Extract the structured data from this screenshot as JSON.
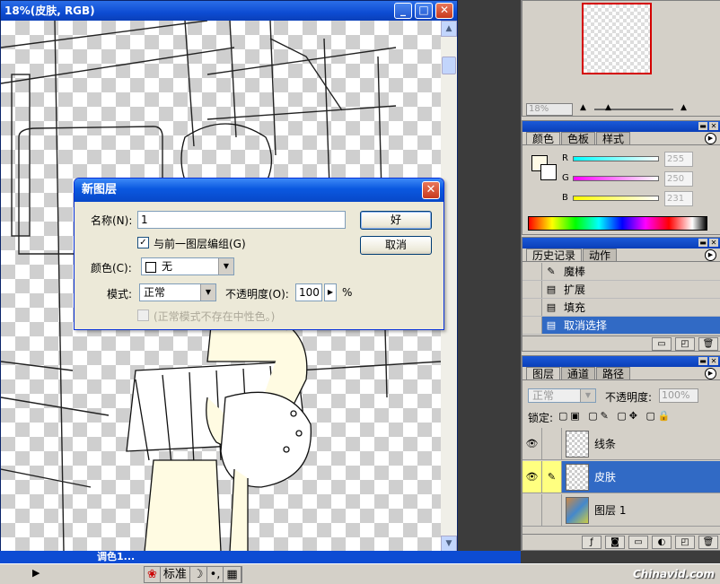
{
  "doc": {
    "title": "18%(皮肤, RGB)",
    "btn_min": "_",
    "btn_max": "□",
    "btn_close": "✕"
  },
  "taskbar": {
    "left_arrow": "▶",
    "task_label": "调色1...",
    "ime": [
      "标准",
      "☽",
      "•,",
      "▦"
    ]
  },
  "watermark": "Chinavid.com",
  "navigator": {
    "zoom": "18%"
  },
  "color_panel": {
    "tabs": [
      "颜色",
      "色板",
      "样式"
    ],
    "channels": [
      {
        "label": "R",
        "value": "255",
        "color": "#00ffff"
      },
      {
        "label": "G",
        "value": "250",
        "color": "#ff00ff"
      },
      {
        "label": "B",
        "value": "231",
        "color": "#ffff00"
      }
    ]
  },
  "history_panel": {
    "tabs": [
      "历史记录",
      "动作"
    ],
    "items": [
      {
        "label": "魔棒",
        "icon": "✎",
        "selected": false
      },
      {
        "label": "扩展",
        "icon": "▤",
        "selected": false
      },
      {
        "label": "填充",
        "icon": "▤",
        "selected": false
      },
      {
        "label": "取消选择",
        "icon": "▤",
        "selected": true
      }
    ]
  },
  "layers_panel": {
    "tabs": [
      "图层",
      "通道",
      "路径"
    ],
    "blend_mode": "正常",
    "opacity_label": "不透明度:",
    "opacity": "100%",
    "lock_label": "锁定:",
    "layers": [
      {
        "name": "线条",
        "eye": "👁",
        "link": "",
        "selected": false
      },
      {
        "name": "皮肤",
        "eye": "👁",
        "link": "✎",
        "selected": true
      },
      {
        "name": "图层 1",
        "eye": "",
        "link": "",
        "selected": false
      }
    ]
  },
  "dialog": {
    "title": "新图层",
    "name_label": "名称(N):",
    "name_value": "1",
    "ok": "好",
    "cancel": "取消",
    "group_checkbox": "与前一图层编组(G)",
    "group_checked": "✓",
    "color_label": "颜色(C):",
    "color_value": "无",
    "mode_label": "模式:",
    "mode_value": "正常",
    "opacity_label": "不透明度(O):",
    "opacity_value": "100",
    "opacity_unit": "%",
    "neutral_text": "(正常模式不存在中性色。)"
  }
}
